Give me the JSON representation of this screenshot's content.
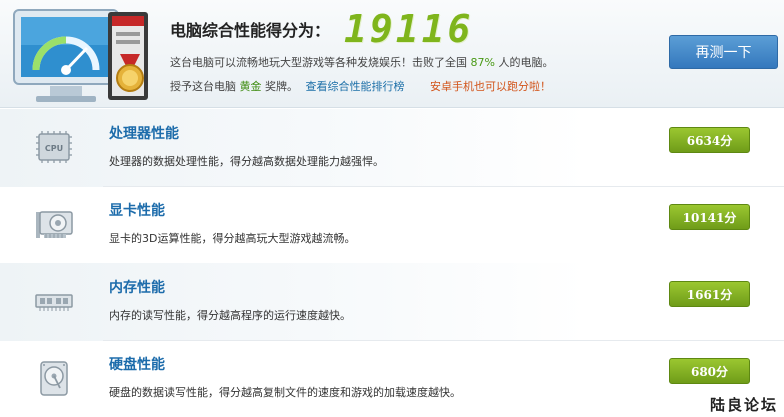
{
  "header": {
    "score_label": "电脑综合性能得分为：",
    "score_value": "19116",
    "desc_pre": "这台电脑可以流畅地玩大型游戏等各种发烧娱乐！击败了全国",
    "desc_pct": "87%",
    "desc_post": "人的电脑。",
    "award_pre": "授予这台电脑",
    "award_medal": "黄金",
    "award_post": "奖牌。",
    "rank_link": "查看综合性能排行榜",
    "android_link": "安卓手机也可以跑分啦！",
    "retest_label": "再测一下"
  },
  "rows": [
    {
      "title": "处理器性能",
      "desc": "处理器的数据处理性能，得分越高数据处理能力越强悍。",
      "score": "6634分",
      "icon": "cpu-icon",
      "chip_text": "CPU"
    },
    {
      "title": "显卡性能",
      "desc": "显卡的3D运算性能，得分越高玩大型游戏越流畅。",
      "score": "10141分",
      "icon": "graphics-card-icon"
    },
    {
      "title": "内存性能",
      "desc": "内存的读写性能，得分越高程序的运行速度越快。",
      "score": "1661分",
      "icon": "memory-icon"
    },
    {
      "title": "硬盘性能",
      "desc": "硬盘的数据读写性能，得分越高复制文件的速度和游戏的加载速度越快。",
      "score": "680分",
      "icon": "hard-disk-icon"
    }
  ],
  "watermark": "陆良论坛",
  "colors": {
    "score_green": "#7fb51c",
    "title_blue": "#1d6cab",
    "badge_green": "#7aa81d",
    "button_blue": "#3d84c8",
    "android_orange": "#d2541a"
  }
}
